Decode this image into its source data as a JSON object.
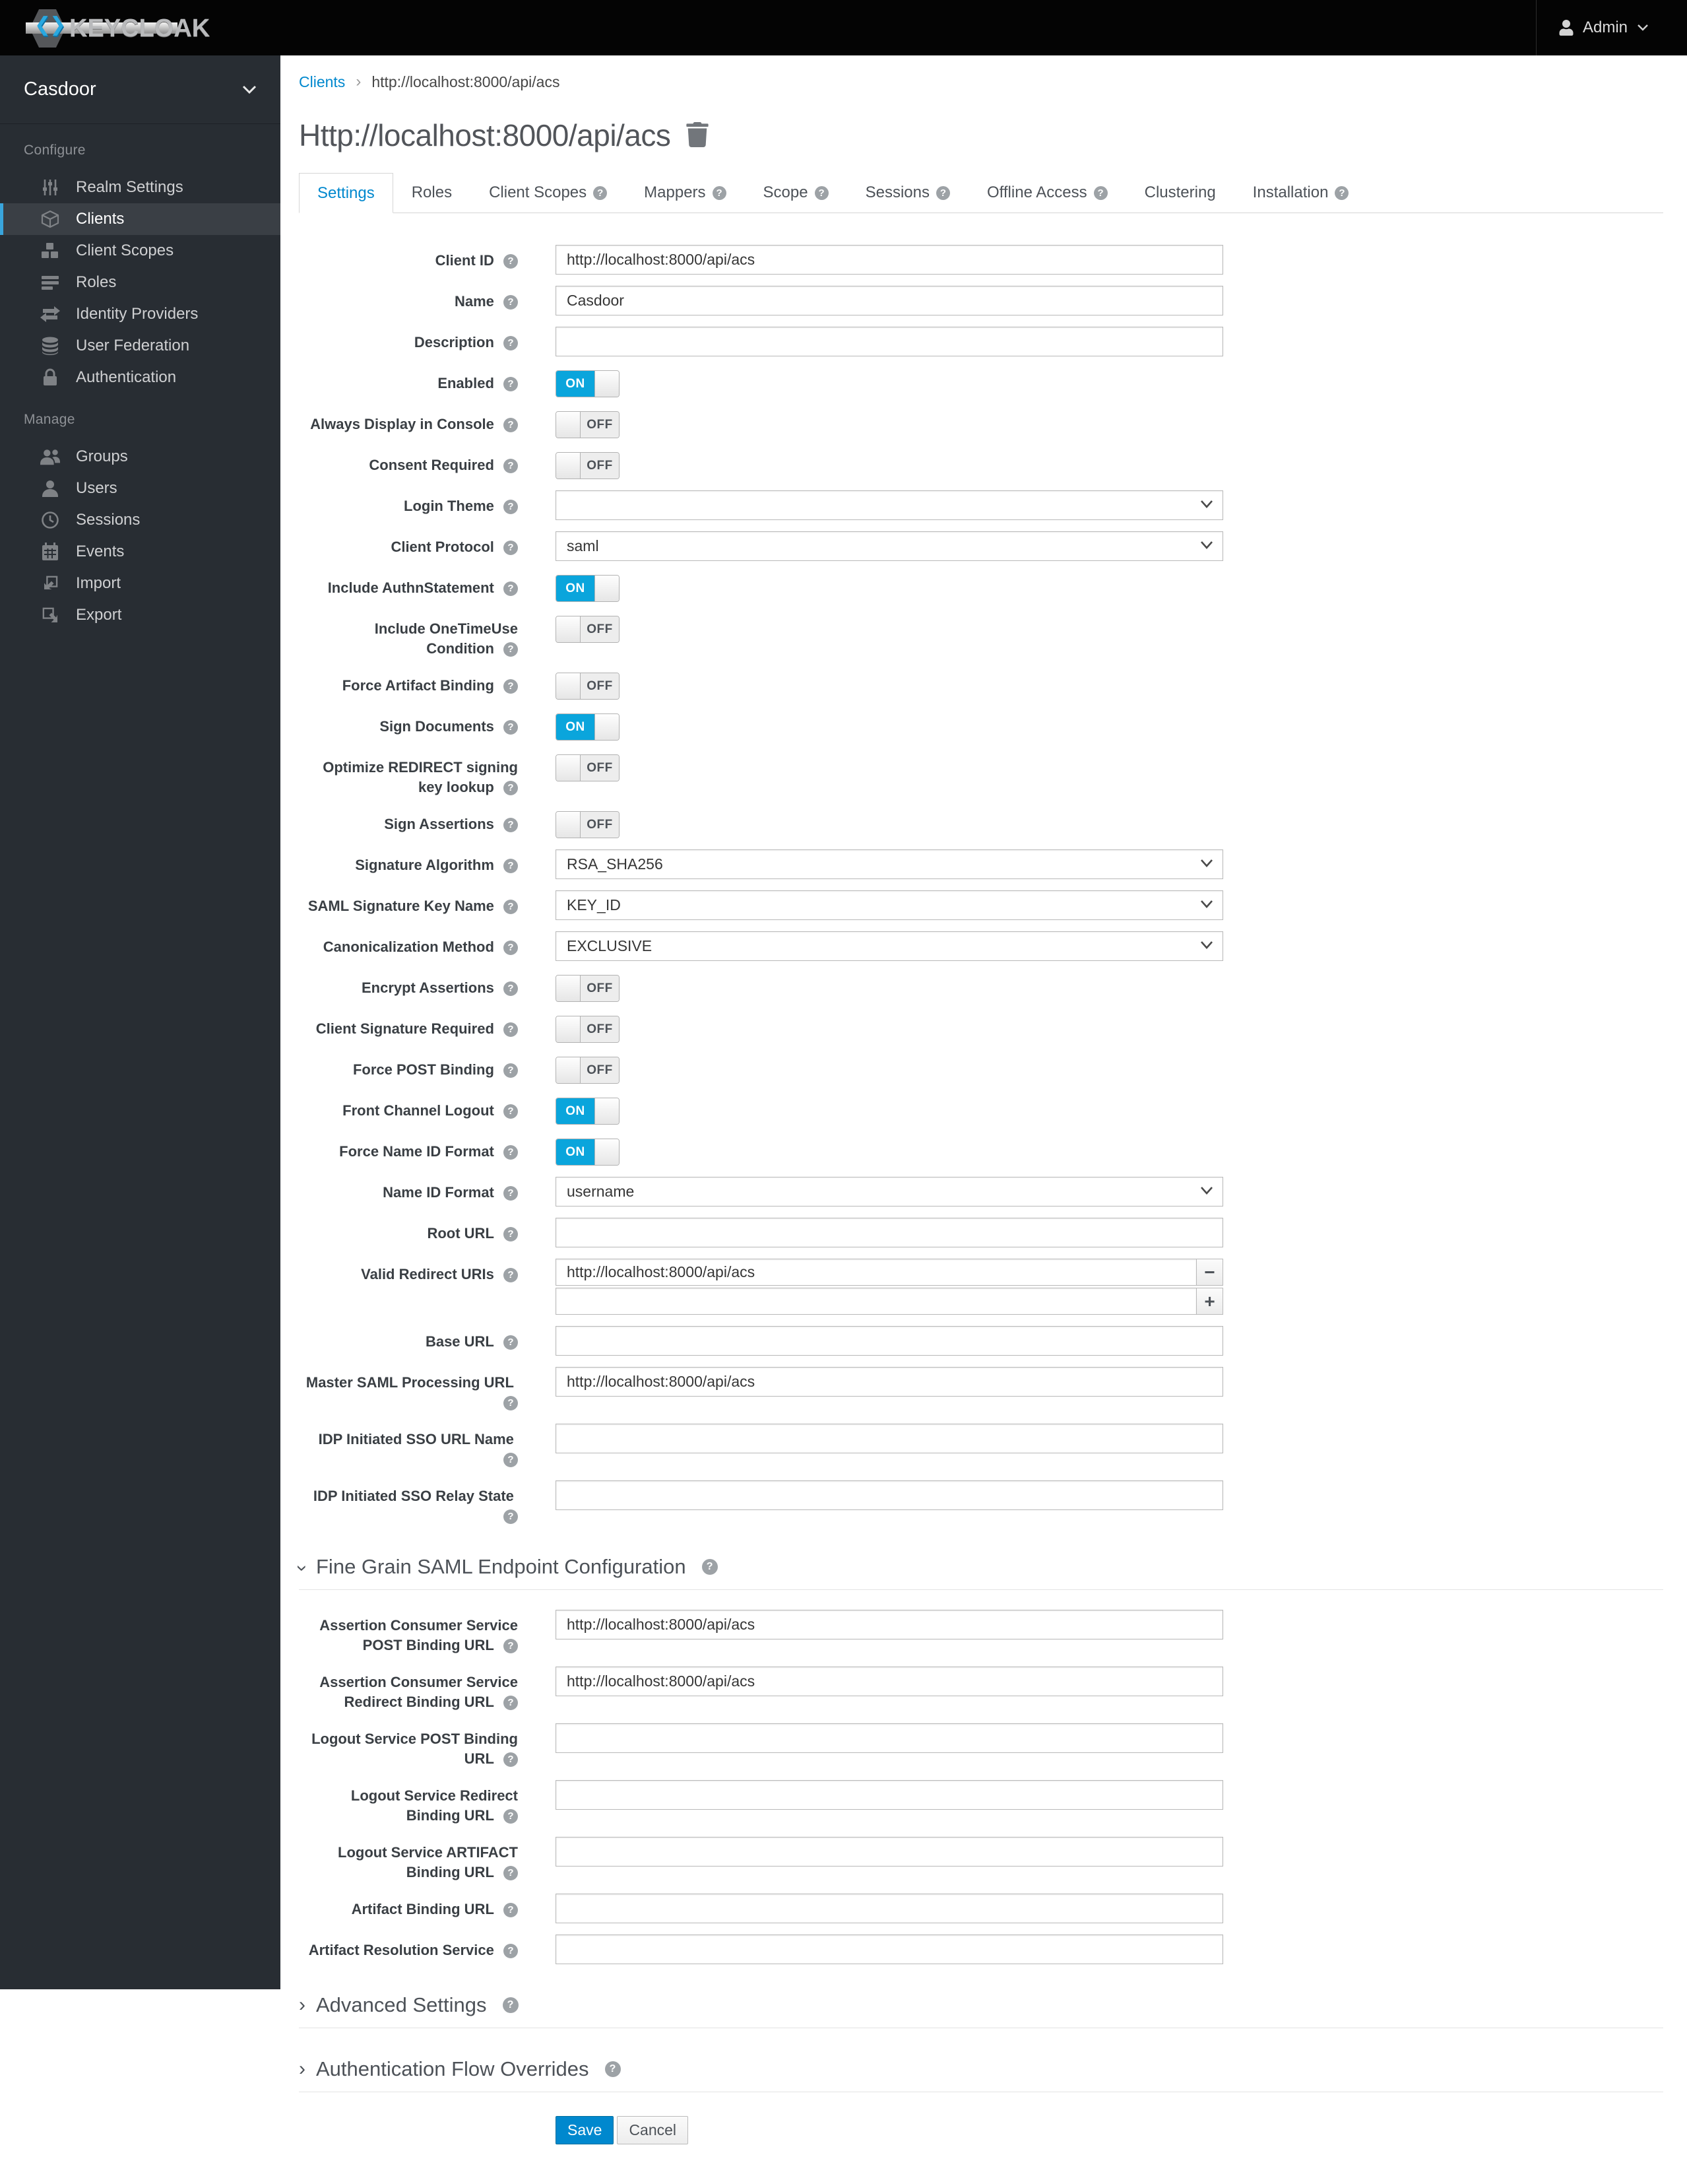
{
  "colors": {
    "accent": "#0088ce",
    "toggle_on": "#0aa5dc",
    "sidebar_bg": "#282d33",
    "navbar_bg": "#040404",
    "active_item_border": "#39a5dc"
  },
  "navbar": {
    "logo_text": "KEYCLOAK",
    "user_label": "Admin"
  },
  "sidebar": {
    "realm": "Casdoor",
    "sections": [
      {
        "label": "Configure",
        "items": [
          {
            "label": "Realm Settings",
            "icon": "sliders-icon",
            "active": false
          },
          {
            "label": "Clients",
            "icon": "cube-icon",
            "active": true
          },
          {
            "label": "Client Scopes",
            "icon": "cubes-icon",
            "active": false
          },
          {
            "label": "Roles",
            "icon": "list-icon",
            "active": false
          },
          {
            "label": "Identity Providers",
            "icon": "exchange-icon",
            "active": false
          },
          {
            "label": "User Federation",
            "icon": "database-icon",
            "active": false
          },
          {
            "label": "Authentication",
            "icon": "lock-icon",
            "active": false
          }
        ]
      },
      {
        "label": "Manage",
        "items": [
          {
            "label": "Groups",
            "icon": "users-icon",
            "active": false
          },
          {
            "label": "Users",
            "icon": "user-icon",
            "active": false
          },
          {
            "label": "Sessions",
            "icon": "clock-icon",
            "active": false
          },
          {
            "label": "Events",
            "icon": "calendar-icon",
            "active": false
          },
          {
            "label": "Import",
            "icon": "import-icon",
            "active": false
          },
          {
            "label": "Export",
            "icon": "export-icon",
            "active": false
          }
        ]
      }
    ]
  },
  "breadcrumb": {
    "parent": "Clients",
    "current": "http://localhost:8000/api/acs"
  },
  "page": {
    "title": "Http://localhost:8000/api/acs"
  },
  "tabs": [
    {
      "label": "Settings",
      "active": true,
      "help": false
    },
    {
      "label": "Roles",
      "active": false,
      "help": false
    },
    {
      "label": "Client Scopes",
      "active": false,
      "help": true
    },
    {
      "label": "Mappers",
      "active": false,
      "help": true
    },
    {
      "label": "Scope",
      "active": false,
      "help": true
    },
    {
      "label": "Sessions",
      "active": false,
      "help": true
    },
    {
      "label": "Offline Access",
      "active": false,
      "help": true
    },
    {
      "label": "Clustering",
      "active": false,
      "help": false
    },
    {
      "label": "Installation",
      "active": false,
      "help": true
    }
  ],
  "form": {
    "rows": [
      {
        "type": "text",
        "name": "client-id",
        "label": "Client ID",
        "value": "http://localhost:8000/api/acs"
      },
      {
        "type": "text",
        "name": "name",
        "label": "Name",
        "value": "Casdoor"
      },
      {
        "type": "text",
        "name": "description",
        "label": "Description",
        "value": ""
      },
      {
        "type": "toggle",
        "name": "enabled",
        "label": "Enabled",
        "state": "ON"
      },
      {
        "type": "toggle",
        "name": "always-display-in-console",
        "label": "Always Display in Console",
        "state": "OFF"
      },
      {
        "type": "toggle",
        "name": "consent-required",
        "label": "Consent Required",
        "state": "OFF"
      },
      {
        "type": "select",
        "name": "login-theme",
        "label": "Login Theme",
        "value": ""
      },
      {
        "type": "select",
        "name": "client-protocol",
        "label": "Client Protocol",
        "value": "saml"
      },
      {
        "type": "toggle",
        "name": "include-authnstatement",
        "label": "Include AuthnStatement",
        "state": "ON"
      },
      {
        "type": "toggle",
        "name": "include-onetimeuse-condition",
        "label": "Include OneTimeUse Condition",
        "state": "OFF"
      },
      {
        "type": "toggle",
        "name": "force-artifact-binding",
        "label": "Force Artifact Binding",
        "state": "OFF"
      },
      {
        "type": "toggle",
        "name": "sign-documents",
        "label": "Sign Documents",
        "state": "ON"
      },
      {
        "type": "toggle",
        "name": "optimize-redirect-signing-key-lookup",
        "label": "Optimize REDIRECT signing key lookup",
        "state": "OFF"
      },
      {
        "type": "toggle",
        "name": "sign-assertions",
        "label": "Sign Assertions",
        "state": "OFF"
      },
      {
        "type": "select",
        "name": "signature-algorithm",
        "label": "Signature Algorithm",
        "value": "RSA_SHA256"
      },
      {
        "type": "select",
        "name": "saml-signature-key-name",
        "label": "SAML Signature Key Name",
        "value": "KEY_ID"
      },
      {
        "type": "select",
        "name": "canonicalization-method",
        "label": "Canonicalization Method",
        "value": "EXCLUSIVE"
      },
      {
        "type": "toggle",
        "name": "encrypt-assertions",
        "label": "Encrypt Assertions",
        "state": "OFF"
      },
      {
        "type": "toggle",
        "name": "client-signature-required",
        "label": "Client Signature Required",
        "state": "OFF"
      },
      {
        "type": "toggle",
        "name": "force-post-binding",
        "label": "Force POST Binding",
        "state": "OFF"
      },
      {
        "type": "toggle",
        "name": "front-channel-logout",
        "label": "Front Channel Logout",
        "state": "ON"
      },
      {
        "type": "toggle",
        "name": "force-name-id-format",
        "label": "Force Name ID Format",
        "state": "ON"
      },
      {
        "type": "select",
        "name": "name-id-format",
        "label": "Name ID Format",
        "value": "username"
      },
      {
        "type": "text",
        "name": "root-url",
        "label": "Root URL",
        "value": ""
      },
      {
        "type": "uri-list",
        "name": "valid-redirect-uris",
        "label": "Valid Redirect URIs",
        "entries": [
          {
            "value": "http://localhost:8000/api/acs",
            "action": "minus",
            "action_symbol": "−"
          },
          {
            "value": "",
            "action": "plus",
            "action_symbol": "+"
          }
        ]
      },
      {
        "type": "text",
        "name": "base-url",
        "label": "Base URL",
        "value": ""
      },
      {
        "type": "text",
        "name": "master-saml-processing-url",
        "label": "Master SAML Processing URL",
        "value": "http://localhost:8000/api/acs"
      },
      {
        "type": "text",
        "name": "idp-initiated-sso-url-name",
        "label": "IDP Initiated SSO URL Name",
        "value": ""
      },
      {
        "type": "text",
        "name": "idp-initiated-sso-relay-state",
        "label": "IDP Initiated SSO Relay State",
        "value": ""
      },
      {
        "type": "section",
        "name": "fine-grain-saml-endpoint-configuration",
        "label": "Fine Grain SAML Endpoint Configuration",
        "expanded": true
      },
      {
        "type": "text",
        "name": "assertion-consumer-service-post-binding-url",
        "label": "Assertion Consumer Service POST Binding URL",
        "value": "http://localhost:8000/api/acs"
      },
      {
        "type": "text",
        "name": "assertion-consumer-service-redirect-binding-url",
        "label": "Assertion Consumer Service Redirect Binding URL",
        "value": "http://localhost:8000/api/acs"
      },
      {
        "type": "text",
        "name": "logout-service-post-binding-url",
        "label": "Logout Service POST Binding URL",
        "value": ""
      },
      {
        "type": "text",
        "name": "logout-service-redirect-binding-url",
        "label": "Logout Service Redirect Binding URL",
        "value": ""
      },
      {
        "type": "text",
        "name": "logout-service-artifact-binding-url",
        "label": "Logout Service ARTIFACT Binding URL",
        "value": ""
      },
      {
        "type": "text",
        "name": "artifact-binding-url",
        "label": "Artifact Binding URL",
        "value": ""
      },
      {
        "type": "text",
        "name": "artifact-resolution-service",
        "label": "Artifact Resolution Service",
        "value": ""
      },
      {
        "type": "section",
        "name": "advanced-settings",
        "label": "Advanced Settings",
        "expanded": false
      },
      {
        "type": "section",
        "name": "authentication-flow-overrides",
        "label": "Authentication Flow Overrides",
        "expanded": false
      },
      {
        "type": "buttons",
        "save_label": "Save",
        "cancel_label": "Cancel"
      }
    ]
  }
}
